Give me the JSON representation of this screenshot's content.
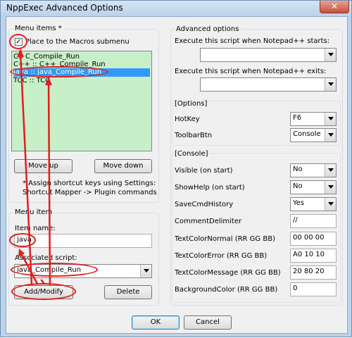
{
  "title": "NppExec Advanced Options",
  "close_glyph": "✕",
  "menu_items": {
    "group_label": "Menu items *",
    "place_checkbox_label": "Place to the Macros submenu",
    "place_checked": true,
    "check_glyph": "✓",
    "list": [
      "C:: C_Compile_Run",
      "C++ :: C++_Compile_Run",
      "java :: java_Compile_Run",
      "TCC :: TCC"
    ],
    "selected_index": 2,
    "move_up_label": "Move up",
    "move_down_label": "Move down",
    "note_line1": "* Assign shortcut keys using Settings:",
    "note_line2": "Shortcut Mapper -> Plugin commands"
  },
  "menu_item": {
    "group_label": "Menu item",
    "item_name_label": "Item name:",
    "item_name_value": "java",
    "associated_script_label": "Associated script:",
    "associated_script_value": "java_Compile_Run",
    "add_modify_label": "Add/Modify",
    "delete_label": "Delete"
  },
  "advanced": {
    "group_label": "Advanced options",
    "on_start_label": "Execute this script when Notepad++ starts:",
    "on_start_value": "",
    "on_exit_label": "Execute this script when Notepad++ exits:",
    "on_exit_value": ""
  },
  "options": {
    "group_label": "[Options]",
    "hotkey_label": "HotKey",
    "hotkey_value": "F6",
    "toolbar_label": "ToolbarBtn",
    "toolbar_value": "Console"
  },
  "console": {
    "group_label": "[Console]",
    "visible_label": "Visible (on start)",
    "visible_value": "No",
    "showhelp_label": "ShowHelp (on start)",
    "showhelp_value": "No",
    "savecmd_label": "SaveCmdHistory",
    "savecmd_value": "Yes",
    "comment_label": "CommentDelimiter",
    "comment_value": "//",
    "color_normal_label": "TextColorNormal (RR GG BB)",
    "color_normal_value": "00 00 00",
    "color_error_label": "TextColorError (RR GG BB)",
    "color_error_value": "A0 10 10",
    "color_message_label": "TextColorMessage (RR GG BB)",
    "color_message_value": "20 80 20",
    "bg_color_label": "BackgroundColor (RR GG BB)",
    "bg_color_value": "0"
  },
  "footer": {
    "ok_label": "OK",
    "cancel_label": "Cancel"
  },
  "colors": {
    "selection": "#3399ff",
    "list_bg": "#c8f0c8",
    "annotation": "#e21d1d"
  }
}
